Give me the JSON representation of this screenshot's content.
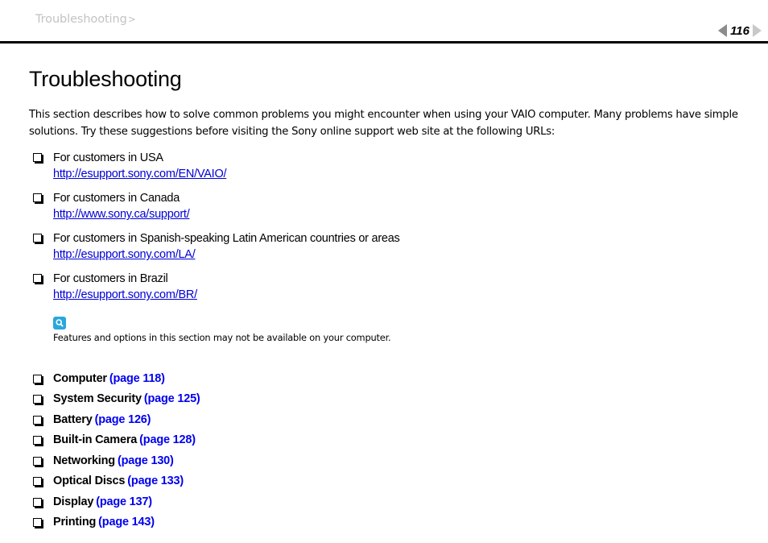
{
  "header": {
    "breadcrumb_text": "Troubleshooting",
    "breadcrumb_separator": ">",
    "page_number": "116",
    "prev_arrow_icon": "triangle-left-icon",
    "next_arrow_icon": "triangle-right-icon",
    "prev_arrow_color": "#8c8c8c",
    "next_arrow_color": "#c8c8c8",
    "breadcrumb_color": "#c3c3c3"
  },
  "main": {
    "title": "Troubleshooting",
    "intro": "This section describes how to solve common problems you might encounter when using your VAIO computer. Many problems have simple solutions. Try these suggestions before visiting the Sony online support web site at the following URLs:",
    "support_list": [
      {
        "label": "For customers in USA",
        "url": "http://esupport.sony.com/EN/VAIO/"
      },
      {
        "label": "For customers in Canada",
        "url": "http://www.sony.ca/support/"
      },
      {
        "label": "For customers in Spanish-speaking Latin American countries or areas",
        "url": "http://esupport.sony.com/LA/"
      },
      {
        "label": "For customers in Brazil",
        "url": "http://esupport.sony.com/BR/"
      }
    ],
    "note": {
      "icon": "magnifier-note-icon",
      "icon_color": "#2aa7dd",
      "text": "Features and options in this section may not be available on your computer."
    },
    "topics": [
      {
        "label": "Computer",
        "page_ref": "(page 118)"
      },
      {
        "label": "System Security",
        "page_ref": "(page 125)"
      },
      {
        "label": "Battery",
        "page_ref": "(page 126)"
      },
      {
        "label": "Built-in Camera",
        "page_ref": "(page 128)"
      },
      {
        "label": "Networking",
        "page_ref": "(page 130)"
      },
      {
        "label": "Optical Discs",
        "page_ref": "(page 133)"
      },
      {
        "label": "Display",
        "page_ref": "(page 137)"
      },
      {
        "label": "Printing",
        "page_ref": "(page 143)"
      }
    ],
    "link_color": "#0000f0",
    "url_color": "#0000d8",
    "bullet_icon": "hollow-square-bullet-icon"
  }
}
